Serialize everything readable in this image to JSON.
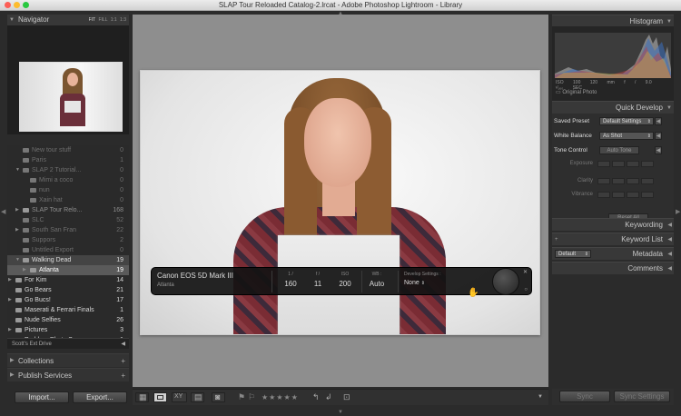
{
  "window": {
    "title": "SLAP Tour Reloaded Catalog-2.lrcat - Adobe Photoshop Lightroom - Library"
  },
  "left": {
    "navigator": {
      "title": "Navigator",
      "zoom_options": [
        "FIT",
        "FILL",
        "1:1",
        "1:3"
      ]
    },
    "folders": [
      {
        "label": "New tour stuff",
        "count": "0",
        "indent": 1,
        "style": "dim"
      },
      {
        "label": "Paris",
        "count": "1",
        "indent": 1,
        "style": "dim"
      },
      {
        "label": "SLAP 2 Tutorial...",
        "count": "0",
        "indent": 1,
        "style": "dim",
        "toggle": "▼"
      },
      {
        "label": "Mimi a coco",
        "count": "0",
        "indent": 2,
        "style": "dim"
      },
      {
        "label": "nun",
        "count": "0",
        "indent": 2,
        "style": "dim"
      },
      {
        "label": "Xain hat",
        "count": "0",
        "indent": 2,
        "style": "dim"
      },
      {
        "label": "SLAP Tour Relo...",
        "count": "168",
        "indent": 1,
        "style": "normal",
        "toggle": "▶"
      },
      {
        "label": "SLC",
        "count": "52",
        "indent": 1,
        "style": "dim"
      },
      {
        "label": "South San Fran",
        "count": "22",
        "indent": 1,
        "style": "dim",
        "toggle": "▶"
      },
      {
        "label": "Suppors",
        "count": "2",
        "indent": 1,
        "style": "dim"
      },
      {
        "label": "Untitled Export",
        "count": "0",
        "indent": 1,
        "style": "dim"
      },
      {
        "label": "Walking Dead",
        "count": "19",
        "indent": 1,
        "style": "hl",
        "toggle": "▼"
      },
      {
        "label": "Atlanta",
        "count": "19",
        "indent": 2,
        "style": "sel",
        "toggle": "▶"
      },
      {
        "label": "For Kim",
        "count": "14",
        "indent": 0,
        "style": "bright",
        "toggle": "▶"
      },
      {
        "label": "Go Bears",
        "count": "21",
        "indent": 0,
        "style": "bright"
      },
      {
        "label": "Go Bucs!",
        "count": "17",
        "indent": 0,
        "style": "bright",
        "toggle": "▶"
      },
      {
        "label": "Maserati & Ferrari Finals",
        "count": "1",
        "indent": 0,
        "style": "bright"
      },
      {
        "label": "Nude Selfies",
        "count": "26",
        "indent": 0,
        "style": "bright"
      },
      {
        "label": "Pictures",
        "count": "3",
        "indent": 0,
        "style": "bright",
        "toggle": "▶"
      },
      {
        "label": "Problem Photo Source",
        "count": "1",
        "indent": 0,
        "style": "bright"
      }
    ],
    "drive": "Scott's Ext Drive",
    "collections": "Collections",
    "publish": "Publish Services",
    "import_label": "Import...",
    "export_label": "Export..."
  },
  "hud": {
    "camera": "Canon EOS 5D Mark III",
    "location": "Atlanta",
    "shutter": {
      "label": "1 /",
      "value": "160"
    },
    "aperture": {
      "label": "f /",
      "value": "11"
    },
    "iso": {
      "label": "ISO",
      "value": "200"
    },
    "wb": {
      "label": "WB :",
      "value": "Auto"
    },
    "develop": {
      "label": "Develop Settings :",
      "value": "None"
    }
  },
  "right": {
    "histogram": {
      "title": "Histogram",
      "iso": "ISO 100",
      "focal": "120 mm",
      "aperture": "f / 9.0",
      "shutter": "¹⁄₁₆₀ SEC",
      "original": "Original Photo"
    },
    "quick_develop": {
      "title": "Quick Develop",
      "saved_preset_label": "Saved Preset",
      "saved_preset_value": "Default Settings",
      "white_balance_label": "White Balance",
      "white_balance_value": "As Shot",
      "tone_control_label": "Tone Control",
      "auto_tone": "Auto Tone",
      "exposure": "Exposure",
      "clarity": "Clarity",
      "vibrance": "Vibrance",
      "reset_all": "Reset All"
    },
    "keywording": "Keywording",
    "keyword_list": "Keyword List",
    "metadata": "Metadata",
    "metadata_preset": "Default",
    "comments": "Comments",
    "sync": "Sync",
    "sync_settings": "Sync Settings"
  },
  "colors": {
    "panel": "#2b2b2b",
    "canvas": "#8e8e8e",
    "selected": "#5a5a5a"
  }
}
